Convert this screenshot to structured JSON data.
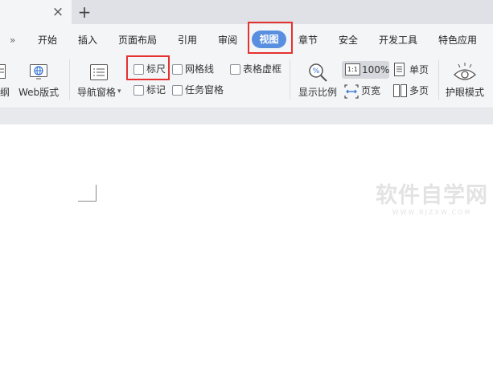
{
  "menu": {
    "items": [
      {
        "key": "overflow",
        "label": "»"
      },
      {
        "key": "start",
        "label": "开始"
      },
      {
        "key": "insert",
        "label": "插入"
      },
      {
        "key": "layout",
        "label": "页面布局"
      },
      {
        "key": "reference",
        "label": "引用"
      },
      {
        "key": "review",
        "label": "审阅"
      },
      {
        "key": "view",
        "label": "视图"
      },
      {
        "key": "chapter",
        "label": "章节"
      },
      {
        "key": "security",
        "label": "安全"
      },
      {
        "key": "devtools",
        "label": "开发工具"
      },
      {
        "key": "special",
        "label": "特色应用"
      }
    ],
    "active": "视图"
  },
  "ribbon": {
    "outline_label": "纲",
    "web_layout_label": "Web版式",
    "nav_pane_label": "导航窗格",
    "nav_pane_arrow": "▾",
    "checkboxes": {
      "ruler": "标尺",
      "gridlines": "网格线",
      "table_virtual_frame": "表格虚框",
      "mark": "标记",
      "task_pane": "任务窗格"
    },
    "zoom_label": "显示比例",
    "zoom_100_badge": "1:1",
    "zoom_100_label": "100%",
    "single_page_label": "单页",
    "page_width_label": "页宽",
    "multi_page_label": "多页",
    "eye_protection_label": "护眼模式"
  },
  "icons": {
    "tab_close": "×",
    "tab_new": "+",
    "web_icon": "globe-icon",
    "nav_icon": "navigation-pane-icon",
    "zoom_icon": "magnifier-percent-icon",
    "single_page_icon": "single-page-icon",
    "page_width_icon": "page-width-icon",
    "multi_page_icon": "multi-page-icon",
    "eye_icon": "eye-icon"
  },
  "colors": {
    "accent": "#5a8fe0",
    "highlight": "#e5312f"
  },
  "watermark": {
    "main": "软件自学网",
    "sub": "WWW.RJZXW.COM"
  }
}
